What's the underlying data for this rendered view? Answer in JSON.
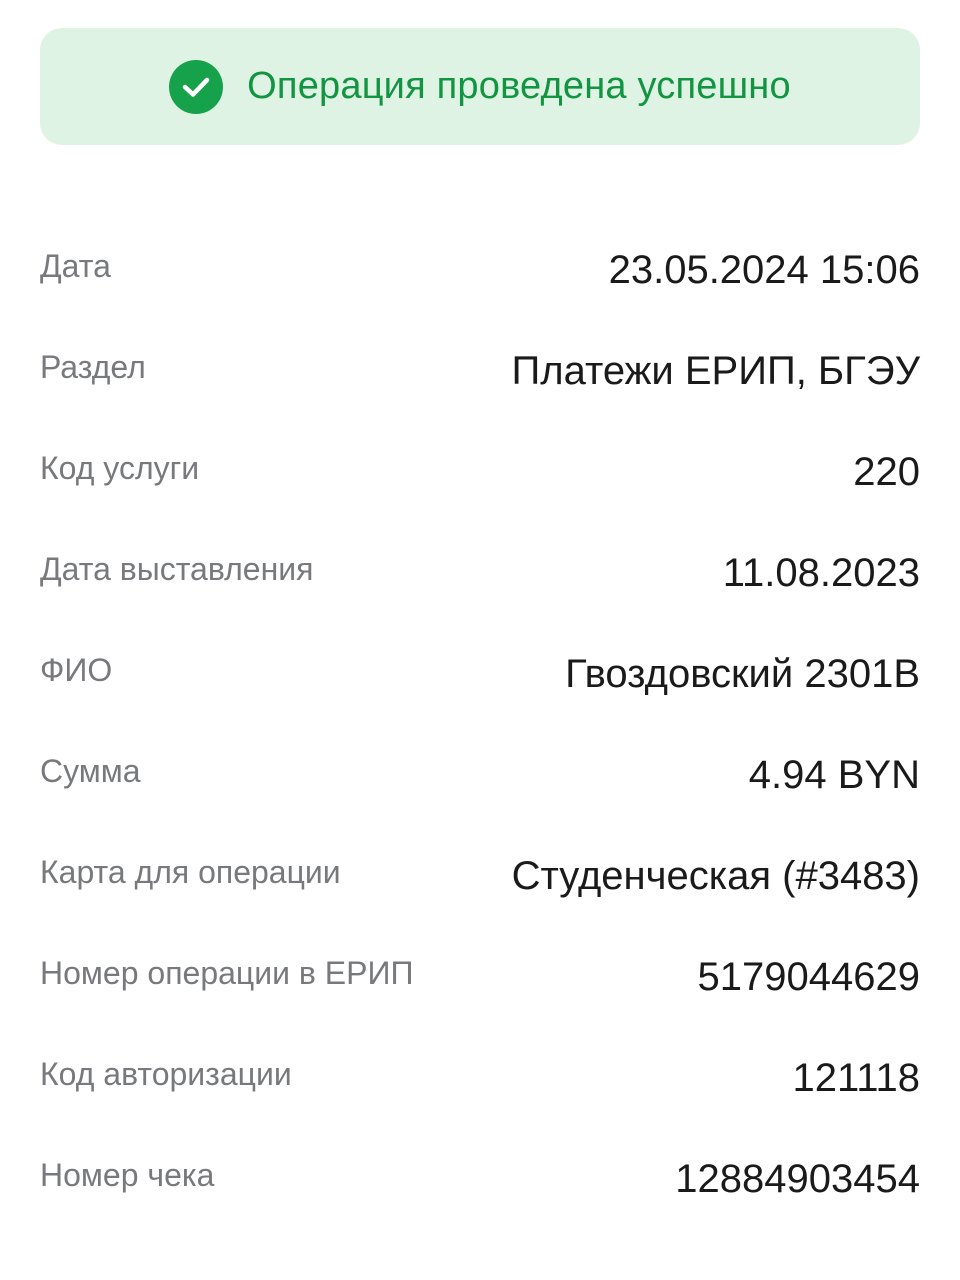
{
  "status": {
    "message": "Операция проведена успешно",
    "icon": "check-circle-icon",
    "color": "#129541",
    "background": "#dff3e5"
  },
  "details": [
    {
      "label": "Дата",
      "value": "23.05.2024 15:06"
    },
    {
      "label": "Раздел",
      "value": "Платежи ЕРИП, БГЭУ"
    },
    {
      "label": "Код услуги",
      "value": "220"
    },
    {
      "label": "Дата выставления",
      "value": "11.08.2023"
    },
    {
      "label": "ФИО",
      "value": "Гвоздовский 2301В"
    },
    {
      "label": "Сумма",
      "value": "4.94 BYN"
    },
    {
      "label": "Карта для операции",
      "value": "Студенческая (#3483)"
    },
    {
      "label": "Номер операции в ЕРИП",
      "value": "5179044629"
    },
    {
      "label": "Код авторизации",
      "value": "121118"
    },
    {
      "label": "Номер чека",
      "value": "12884903454"
    }
  ]
}
